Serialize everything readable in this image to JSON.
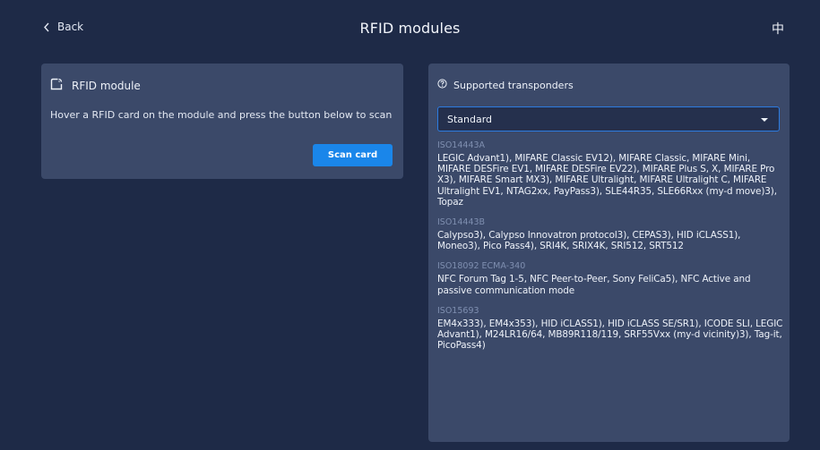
{
  "header": {
    "back_label": "Back",
    "title": "RFID modules",
    "language_toggle": "中"
  },
  "rfid_card": {
    "title": "RFID module",
    "instruction": "Hover a RFID card on the module and press the button below to scan",
    "scan_button": "Scan card"
  },
  "transponders_card": {
    "title": "Supported transponders",
    "select_value": "Standard",
    "standards": [
      {
        "name": "ISO14443A",
        "items": "LEGIC Advant1), MIFARE Classic EV12), MIFARE Classic, MIFARE Mini, MIFARE DESFire EV1, MIFARE DESFire EV22), MIFARE Plus S, X, MIFARE Pro X3), MIFARE Smart MX3), MIFARE Ultralight, MIFARE Ultralight C, MIFARE Ultralight EV1, NTAG2xx, PayPass3), SLE44R35, SLE66Rxx (my-d move)3), Topaz"
      },
      {
        "name": "ISO14443B",
        "items": "Calypso3), Calypso Innovatron protocol3), CEPAS3), HID iCLASS1), Moneo3), Pico Pass4), SRI4K, SRIX4K, SRI512, SRT512"
      },
      {
        "name": "ISO18092 ECMA-340",
        "items": "NFC Forum Tag 1-5, NFC Peer-to-Peer, Sony FeliCa5), NFC Active and passive communication mode"
      },
      {
        "name": "ISO15693",
        "items": "EM4x333), EM4x353), HID iCLASS1), HID iCLASS SE/SR1), ICODE SLI, LEGIC Advant1), M24LR16/64, MB89R118/119, SRF55Vxx (my-d vicinity)3), Tag-it, PicoPass4)"
      }
    ]
  },
  "colors": {
    "background": "#1e2a47",
    "card": "#3b4969",
    "accent": "#1a86ea",
    "muted_text": "#7f8fb0"
  }
}
